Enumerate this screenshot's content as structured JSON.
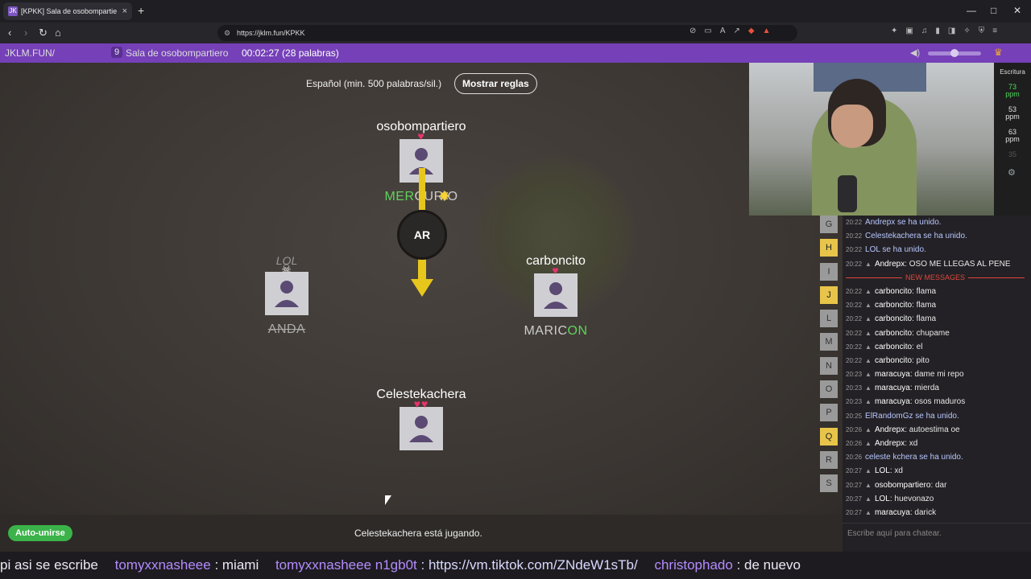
{
  "browser": {
    "tab_title": "[KPKK] Sala de osobompartie",
    "url": "https://jklm.fun/KPKK",
    "new_tab": "+",
    "close": "×"
  },
  "header": {
    "brand": "JKLM.FUN/",
    "room_count": "9",
    "room_name": "Sala de osobompartiero",
    "timer": "00:02:27 (28 palabras)"
  },
  "game": {
    "language": "Español (min. 500 palabras/sil.)",
    "rules_button": "Mostrar reglas",
    "bomb_syllable": "AR",
    "status": "Celestekachera está jugando.",
    "auto_join": "Auto-unirse",
    "players": [
      {
        "name": "osobompartiero",
        "hearts": "♥",
        "word_hl": "MER",
        "word_rest": "CURIO"
      },
      {
        "name": "LOL",
        "hearts": "☠",
        "word_hl": "",
        "word_rest": "ANDA"
      },
      {
        "name": "carboncito",
        "hearts": "♥",
        "word_hl": "ON",
        "word_rest": "MARIC"
      },
      {
        "name": "Celestekachera",
        "hearts": "♥♥",
        "word_hl": "",
        "word_rest": ""
      }
    ]
  },
  "stats": {
    "title": "Escritura",
    "values": [
      "73",
      "53",
      "63",
      "35"
    ],
    "unit": "ppm"
  },
  "letters": [
    "G",
    "H",
    "I",
    "J",
    "L",
    "M",
    "N",
    "O",
    "P",
    "Q",
    "R",
    "S"
  ],
  "letters_highlight": [
    "H",
    "J",
    "Q"
  ],
  "chat": {
    "messages": [
      {
        "t": "20:22",
        "text": "Andrepx se ha unido.",
        "sys": true
      },
      {
        "t": "20:22",
        "text": "Celestekachera se ha unido.",
        "sys": true
      },
      {
        "t": "20:22",
        "text": "LOL se ha unido.",
        "sys": true
      },
      {
        "t": "20:22",
        "name": "Andrepx",
        "text": ": OSO ME LLEGAS AL PENE"
      },
      {
        "t": "20:22",
        "name": "carboncito",
        "text": ": flama"
      },
      {
        "t": "20:22",
        "name": "carboncito",
        "text": ": flama"
      },
      {
        "t": "20:22",
        "name": "carboncito",
        "text": ": flama"
      },
      {
        "t": "20:22",
        "name": "carboncito",
        "text": ": chupame"
      },
      {
        "t": "20:22",
        "name": "carboncito",
        "text": ": el"
      },
      {
        "t": "20:22",
        "name": "carboncito",
        "text": ": pito"
      },
      {
        "t": "20:23",
        "name": "maracuya",
        "text": ": dame mi repo"
      },
      {
        "t": "20:23",
        "name": "maracuya",
        "text": ": mierda"
      },
      {
        "t": "20:23",
        "name": "maracuya",
        "text": ": osos maduros"
      },
      {
        "t": "20:25",
        "text": "ElRandomGz se ha unido.",
        "sys": true
      },
      {
        "t": "20:26",
        "name": "Andrepx",
        "text": ": autoestima oe"
      },
      {
        "t": "20:26",
        "name": "Andrepx",
        "text": ": xd"
      },
      {
        "t": "20:26",
        "text": "celeste kchera se ha unido.",
        "sys": true
      },
      {
        "t": "20:27",
        "name": "LOL",
        "text": ": xd"
      },
      {
        "t": "20:27",
        "name": "osobompartiero",
        "text": ": dar"
      },
      {
        "t": "20:27",
        "name": "LOL",
        "text": ": huevonazo"
      },
      {
        "t": "20:27",
        "name": "maracuya",
        "text": ": darick"
      }
    ],
    "new_messages": "NEW MESSAGES",
    "input_placeholder": "Escribe aquí para chatear."
  },
  "ticker": {
    "part1": "pi asi se escribe",
    "user1": "tomyxxnasheee",
    "msg1": ": miami",
    "user2": "tomyxxnasheee",
    "user3": "n1gb0t",
    "link": ": https://vm.tiktok.com/ZNdeW1sTb/",
    "user4": "christophado",
    "msg4": ": de nuevo"
  }
}
